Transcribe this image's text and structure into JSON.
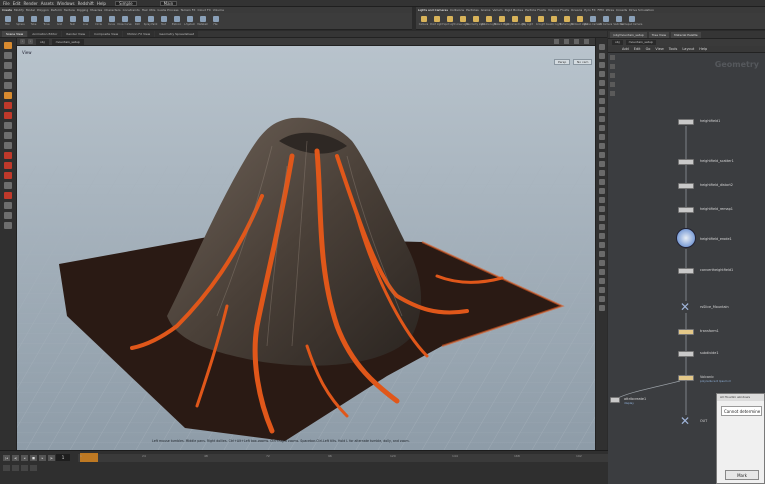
{
  "menubar": {
    "items": [
      "File",
      "Edit",
      "Render",
      "Assets",
      "Windows",
      "Redshift",
      "Help"
    ],
    "desktop": "Simple",
    "main": "Main"
  },
  "shelf": {
    "tabs_left": [
      "Create",
      "Modify",
      "Model",
      "Polygon",
      "Deform",
      "Texture",
      "Rigging",
      "Muscles",
      "Characters",
      "Constraints",
      "Hair Utils",
      "Guide Process",
      "Terrain FX",
      "Cloud FX",
      "Volume"
    ],
    "tabs_right": [
      "Lights and Cameras",
      "Collisions",
      "Particles",
      "Grains",
      "Vellum",
      "Rigid Bodies",
      "Particle Fluids",
      "Viscous Fluids",
      "Oceans",
      "Pyro FX",
      "FEM",
      "Wires",
      "Crowds",
      "Drive Simulation"
    ],
    "tools_left": [
      "Box",
      "Sphere",
      "Tube",
      "Torus",
      "Grid",
      "Null",
      "Line",
      "Circle",
      "Curve",
      "Draw Curve",
      "Path",
      "Spray Paint",
      "Text",
      "Platonic",
      "L-System",
      "Metaball",
      "File"
    ],
    "tools_right": [
      "Camera",
      "Point Light",
      "Spot Light",
      "Area Light",
      "Geometry Light",
      "Volume Light",
      "Distant Light",
      "Environment Light",
      "Sky Light",
      "GI Light",
      "Caustic Light",
      "Portal Light",
      "Ambient Light",
      "Stereo Camera",
      "VR Camera",
      "Switcher",
      "Gamepad Camera"
    ]
  },
  "viewport_tabs": [
    "Scene View",
    "Animation Editor",
    "Render View",
    "Composite View",
    "Motion FX View",
    "Geometry Spreadsheet"
  ],
  "viewport": {
    "path_label": "obj",
    "node_label": "mountain_setup",
    "view_label": "View",
    "persp": "Persp",
    "cam": "No cam",
    "status": "Left mouse tumbles. Middle pans. Right dollies. Ctrl+Alt+Left box-zooms. Ctrl+Right zooms. Spacebar-Ctrl-Left tilts. Hold L for alternate tumble, dolly, and zoom."
  },
  "timeline": {
    "frame": "1",
    "ticks": [
      "1",
      "24",
      "48",
      "72",
      "96",
      "120",
      "144",
      "168",
      "192",
      "216",
      "240"
    ]
  },
  "network_tabs": [
    "/obj/mountain_setup",
    "Tree View",
    "Material Palette"
  ],
  "network_path": [
    "obj",
    "mountain_setup"
  ],
  "network_menu": [
    "Add",
    "Edit",
    "Go",
    "View",
    "Tools",
    "Layout",
    "Help"
  ],
  "network_context": "Geometry",
  "nodes": [
    {
      "label": "heightfield1",
      "sub": ""
    },
    {
      "label": "heightfield_scatter1",
      "sub": ""
    },
    {
      "label": "heightfield_distort2",
      "sub": ""
    },
    {
      "label": "heightfield_remap1",
      "sub": ""
    },
    {
      "label": "heightfield_erode1",
      "sub": ""
    },
    {
      "label": "convertheightfield1",
      "sub": ""
    },
    {
      "label": "rsSlice_Mountain",
      "sub": ""
    },
    {
      "label": "transform1",
      "sub": ""
    },
    {
      "label": "subdivide1",
      "sub": ""
    },
    {
      "label": "Volcanic",
      "sub": "polyreduce 0 Ipsum m"
    },
    {
      "label": "OUT",
      "sub": ""
    },
    {
      "label": "attribcreate1",
      "sub": "display"
    }
  ],
  "dialog": {
    "title": "All Houdini windows",
    "message": "Cannot determine",
    "ok": "Mark"
  },
  "colors": {
    "lava": "#e0571a",
    "rock": "#4a4038",
    "ground": "#2a1a14",
    "sky_top": "#b8c3cc",
    "sky_bottom": "#8e9ca8",
    "network_bg": "#3b3d40"
  }
}
